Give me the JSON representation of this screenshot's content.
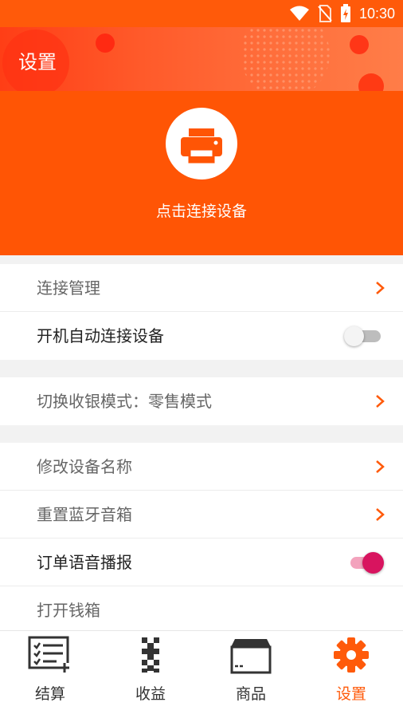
{
  "status": {
    "time": "10:30"
  },
  "header": {
    "title": "设置"
  },
  "hero": {
    "label": "点击连接设备"
  },
  "settings": {
    "group1": [
      {
        "label": "连接管理",
        "kind": "link"
      },
      {
        "label": "开机自动连接设备",
        "kind": "toggle",
        "enabled": false
      }
    ],
    "group2": [
      {
        "label": "切换收银模式：零售模式",
        "kind": "link"
      }
    ],
    "group3": [
      {
        "label": "修改设备名称",
        "kind": "link"
      },
      {
        "label": "重置蓝牙音箱",
        "kind": "link"
      },
      {
        "label": "订单语音播报",
        "kind": "toggle",
        "enabled": true
      },
      {
        "label": "打开钱箱",
        "kind": "link"
      }
    ]
  },
  "tabbar": {
    "tabs": [
      {
        "label": "结算",
        "icon": "checkout-list-icon"
      },
      {
        "label": "收益",
        "icon": "qr-earnings-icon"
      },
      {
        "label": "商品",
        "icon": "product-box-icon"
      },
      {
        "label": "设置",
        "icon": "gear-icon",
        "active": true
      }
    ]
  },
  "colors": {
    "accent": "#ff5a0a",
    "toggle_on": "#d8145f"
  }
}
